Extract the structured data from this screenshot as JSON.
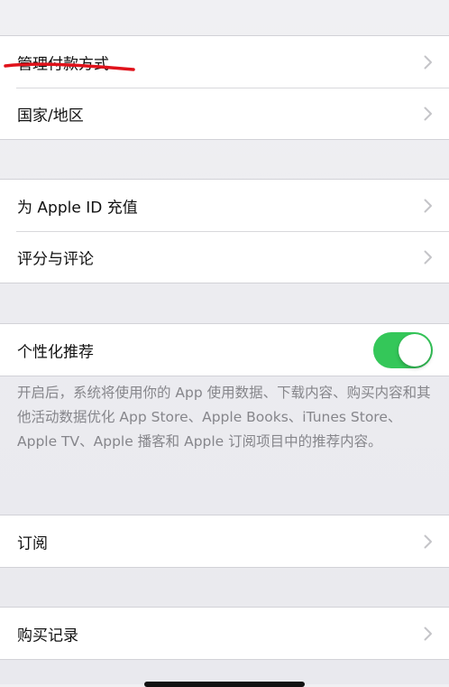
{
  "account_group": {
    "items": [
      {
        "label": "管理付款方式"
      },
      {
        "label": "国家/地区"
      }
    ]
  },
  "apple_id_group": {
    "items": [
      {
        "label": "为 Apple ID 充值"
      },
      {
        "label": "评分与评论"
      }
    ]
  },
  "personalization": {
    "label": "个性化推荐",
    "toggle_on": true,
    "toggle_color": "#34c759",
    "footnote": "开启后，系统将使用你的 App 使用数据、下载内容、购买内容和其他活动数据优化 App Store、Apple Books、iTunes Store、Apple TV、Apple 播客和 Apple 订阅项目中的推荐内容。"
  },
  "subscriptions_group": {
    "items": [
      {
        "label": "订阅"
      }
    ]
  },
  "purchases_group": {
    "items": [
      {
        "label": "购买记录"
      }
    ]
  },
  "annotation": {
    "color": "#e0121b",
    "description": "red-underline-mark"
  }
}
